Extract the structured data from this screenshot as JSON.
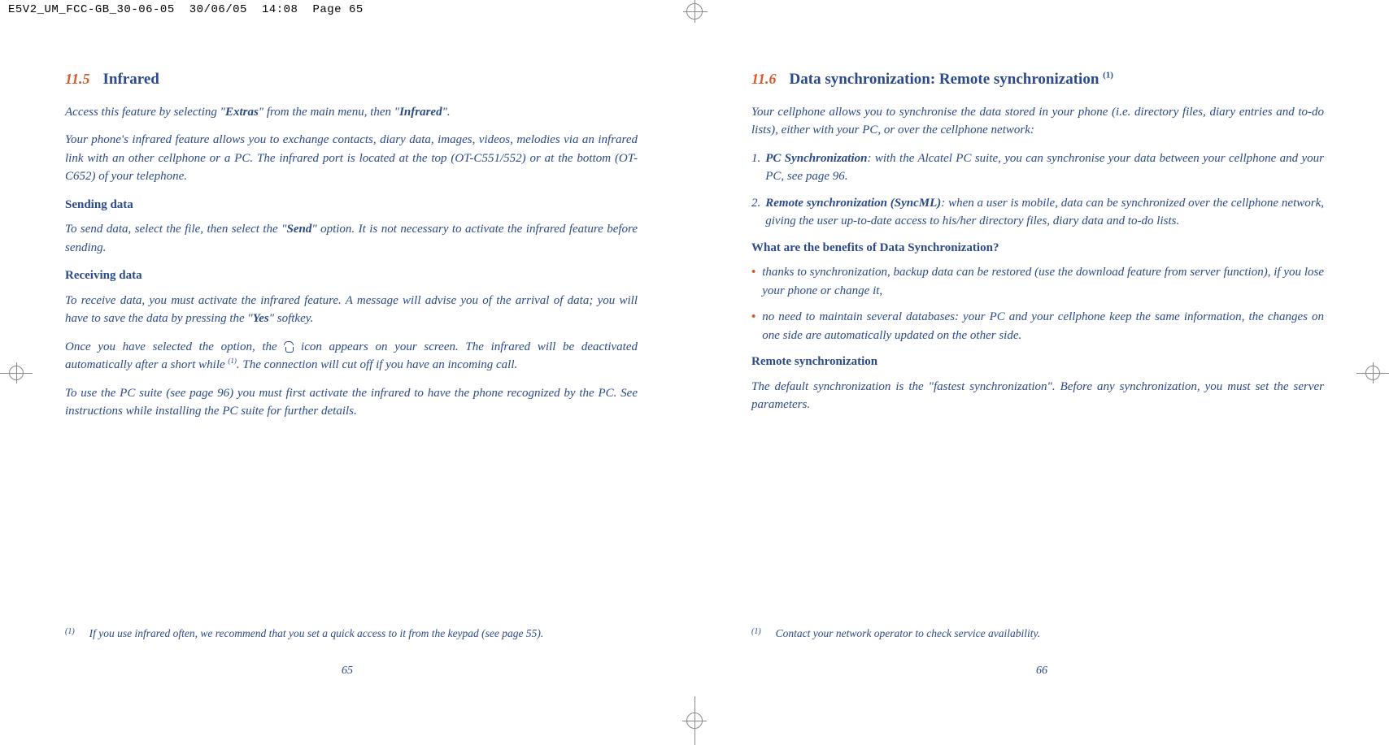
{
  "header": {
    "file": "E5V2_UM_FCC-GB_30-06-05",
    "date": "30/06/05",
    "time": "14:08",
    "pageref": "Page 65"
  },
  "left": {
    "secnum": "11.5",
    "sectitle": "Infrared",
    "p1a": "Access this feature by selecting \"",
    "p1b": "Extras",
    "p1c": "\" from the main menu, then \"",
    "p1d": "Infrared",
    "p1e": "\".",
    "p2": "Your phone's infrared feature allows you to exchange contacts, diary data, images, videos, melodies via an infrared link with an other cellphone or a PC. The infrared port is located at the top (OT-C551/552) or at the bottom (OT-C652) of your telephone.",
    "sub1": "Sending data",
    "p3a": "To send data, select the file, then select the \"",
    "p3b": "Send",
    "p3c": "\" option. It is not necessary to activate the infrared feature before sending.",
    "sub2": "Receiving data",
    "p4a": "To receive data, you must activate the infrared feature. A message will advise you of the arrival of data; you will have to save the data by pressing the \"",
    "p4b": "Yes",
    "p4c": "\" softkey.",
    "p5a": "Once you have selected the option, the ",
    "p5b": " icon appears on your screen. The infrared will be deactivated automatically after a short while ",
    "p5fn": "(1)",
    "p5c": ". The connection will cut off if you have an incoming call.",
    "p6": "To use the PC suite (see page 96) you must first activate the infrared to have the phone recognized by the PC. See instructions while installing the PC suite for further details.",
    "fnmark": "(1)",
    "fntext": "If you use infrared often, we recommend that you set a quick access to it from the keypad (see page 55).",
    "pagenum": "65"
  },
  "right": {
    "secnum": "11.6",
    "sectitle": "Data synchronization: Remote synchronization ",
    "secfn": "(1)",
    "p1": "Your cellphone allows you to synchronise the data stored in your phone (i.e. directory files, diary entries and to-do lists), either with your PC, or over the cellphone network:",
    "li1a": "PC Synchronization",
    "li1b": ": with the Alcatel PC suite, you can synchronise your data between your cellphone and your PC, see page 96.",
    "li2a": "Remote synchronization (SyncML)",
    "li2b": ": when a user is mobile, data can be synchronized over the cellphone network, giving the user up-to-date access to his/her directory files, diary data and to-do lists.",
    "sub1": "What are the benefits of Data Synchronization?",
    "b1": "thanks to synchronization, backup data can be restored (use the download feature from server function), if you lose your phone or change it,",
    "b2": "no need to maintain several databases: your PC and your cellphone keep the same information, the changes on one side are automatically updated on the other side.",
    "sub2": "Remote synchronization",
    "p2": "The default synchronization is the \"fastest synchronization\". Before any synchronization, you must set the server parameters.",
    "fnmark": "(1)",
    "fntext": "Contact your network operator to check service availability.",
    "pagenum": "66"
  }
}
